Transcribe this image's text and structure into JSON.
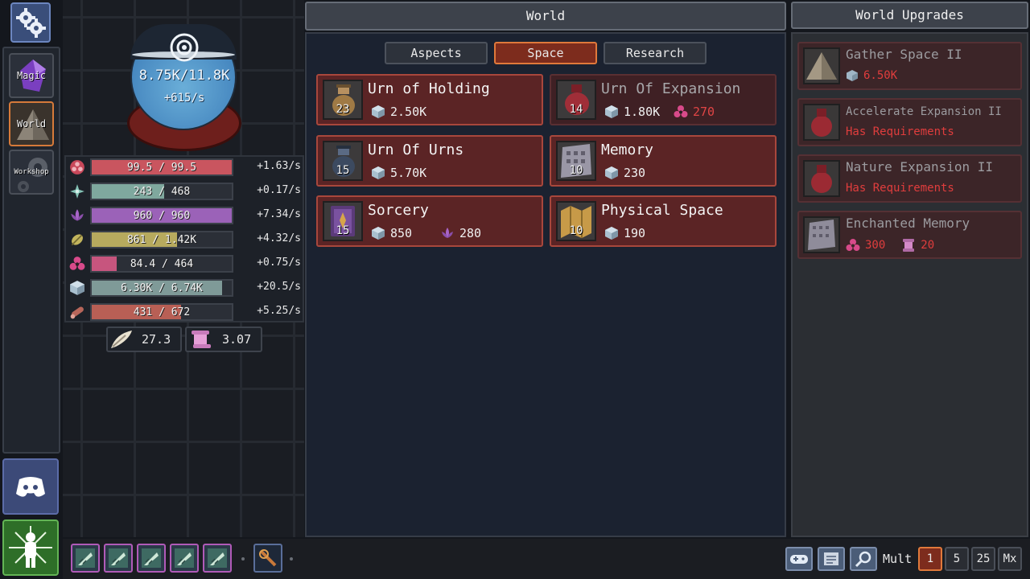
{
  "nav": {
    "items": [
      {
        "label": "Magic",
        "icon": "magic-crystal-icon"
      },
      {
        "label": "World",
        "icon": "world-pyramid-icon",
        "active": true
      },
      {
        "label": "Workshop",
        "icon": "workshop-gear-icon"
      }
    ]
  },
  "orb": {
    "value": "8.75K/11.8K",
    "rate": "+615/s"
  },
  "resources": [
    {
      "icon": "mana-flower-icon",
      "text": "99.5 / 99.5",
      "rate": "+1.63/s",
      "fill": 1.0,
      "color": "#c9555f"
    },
    {
      "icon": "air-star-icon",
      "text": "243 / 468",
      "rate": "+0.17/s",
      "fill": 0.52,
      "color": "#7fa89e"
    },
    {
      "icon": "lotus-icon",
      "text": "960 / 960",
      "rate": "+7.34/s",
      "fill": 1.0,
      "color": "#9b62b8"
    },
    {
      "icon": "leaf-icon",
      "text": "861 / 1.42K",
      "rate": "+4.32/s",
      "fill": 0.61,
      "color": "#b7aa5e"
    },
    {
      "icon": "pink-flower-icon",
      "text": "84.4 / 464",
      "rate": "+0.75/s",
      "fill": 0.18,
      "color": "#c7557e"
    },
    {
      "icon": "space-cube-icon",
      "text": "6.30K / 6.74K",
      "rate": "+20.5/s",
      "fill": 0.93,
      "color": "#7f9a98"
    },
    {
      "icon": "scroll-log-icon",
      "text": "431 / 672",
      "rate": "+5.25/s",
      "fill": 0.64,
      "color": "#b85f55"
    }
  ],
  "mini_stats": [
    {
      "icon": "feather-icon",
      "value": "27.3"
    },
    {
      "icon": "scroll-icon",
      "value": "3.07"
    }
  ],
  "world": {
    "title": "World",
    "tabs": [
      "Aspects",
      "Space",
      "Research"
    ],
    "active_tab": "Space",
    "cards": [
      {
        "title": "Urn of Holding",
        "count": "23",
        "costs": [
          {
            "icon": "space-cube-icon",
            "value": "2.50K",
            "red": false
          }
        ],
        "dim": false
      },
      {
        "title": "Urn Of Expansion",
        "count": "14",
        "costs": [
          {
            "icon": "space-cube-icon",
            "value": "1.80K",
            "red": false
          },
          {
            "icon": "pink-flower-icon",
            "value": "270",
            "red": true
          }
        ],
        "dim": true
      },
      {
        "title": "Urn Of Urns",
        "count": "15",
        "costs": [
          {
            "icon": "space-cube-icon",
            "value": "5.70K",
            "red": false
          }
        ],
        "dim": false
      },
      {
        "title": "Memory",
        "count": "10",
        "costs": [
          {
            "icon": "space-cube-icon",
            "value": "230",
            "red": false
          }
        ],
        "dim": false
      },
      {
        "title": "Sorcery",
        "count": "15",
        "costs": [
          {
            "icon": "space-cube-icon",
            "value": "850",
            "red": false
          },
          {
            "icon": "lotus-icon",
            "value": "280",
            "red": false
          }
        ],
        "dim": false
      },
      {
        "title": "Physical Space",
        "count": "10",
        "costs": [
          {
            "icon": "space-cube-icon",
            "value": "190",
            "red": false
          }
        ],
        "dim": false
      }
    ]
  },
  "upgrades": {
    "title": "World Upgrades",
    "items": [
      {
        "title": "Gather Space II",
        "sub": "6.50K",
        "sub_icon": "space-cube-icon"
      },
      {
        "title": "Accelerate Expansion II",
        "sub": "Has Requirements"
      },
      {
        "title": "Nature Expansion II",
        "sub": "Has Requirements"
      },
      {
        "title": "Enchanted Memory",
        "costs": [
          {
            "icon": "pink-flower-icon",
            "value": "300"
          },
          {
            "icon": "scroll-icon",
            "value": "20"
          }
        ]
      }
    ]
  },
  "bottom": {
    "mult_label": "Mult",
    "mult_options": [
      "1",
      "5",
      "25",
      "Mx"
    ],
    "mult_active": "1"
  }
}
